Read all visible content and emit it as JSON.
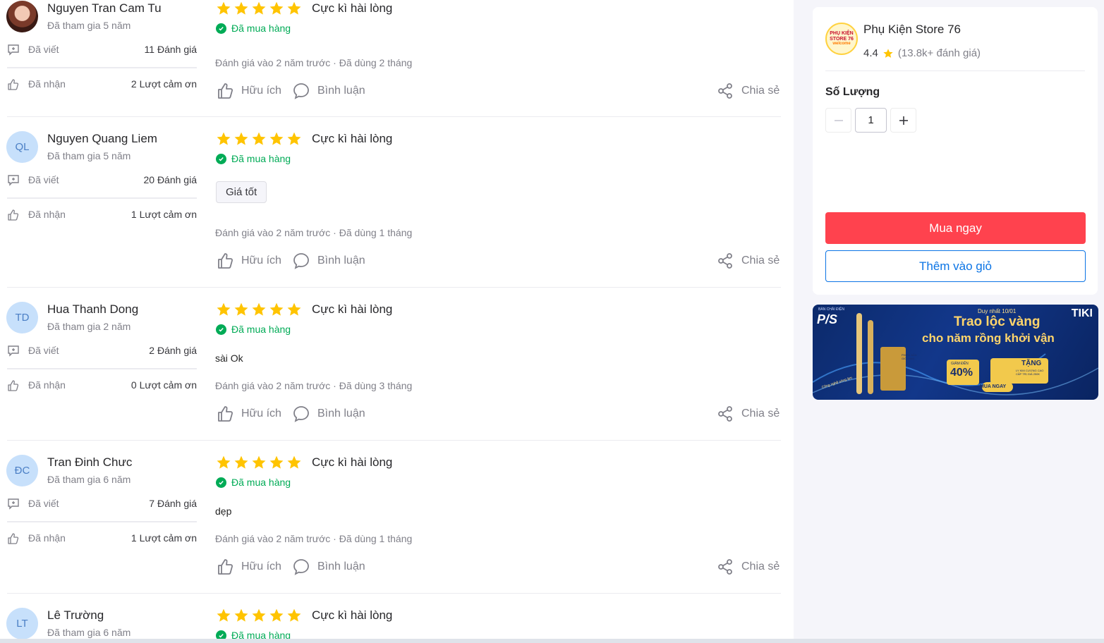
{
  "reviews": [
    {
      "name": "Nguyen Tran Cam Tu",
      "initials": "",
      "joined": "Đã tham gia 5 năm",
      "written_label": "Đã viết",
      "written_value": "11 Đánh giá",
      "received_label": "Đã nhận",
      "received_value": "2 Lượt cảm ơn",
      "rating": 5,
      "rating_title": "Cực kì hài lòng",
      "bought": "Đã mua hàng",
      "tag": "",
      "content": "",
      "meta": "Đánh giá vào 2 năm trước  ·  Đã dùng 2 tháng",
      "helpful": "Hữu ích",
      "comment": "Bình luận",
      "share": "Chia sẻ"
    },
    {
      "name": "Nguyen Quang Liem",
      "initials": "QL",
      "joined": "Đã tham gia 5 năm",
      "written_label": "Đã viết",
      "written_value": "20 Đánh giá",
      "received_label": "Đã nhận",
      "received_value": "1 Lượt cảm ơn",
      "rating": 5,
      "rating_title": "Cực kì hài lòng",
      "bought": "Đã mua hàng",
      "tag": "Giá tốt",
      "content": "",
      "meta": "Đánh giá vào 2 năm trước  ·  Đã dùng 1 tháng",
      "helpful": "Hữu ích",
      "comment": "Bình luận",
      "share": "Chia sẻ"
    },
    {
      "name": "Hua Thanh Dong",
      "initials": "TD",
      "joined": "Đã tham gia 2 năm",
      "written_label": "Đã viết",
      "written_value": "2 Đánh giá",
      "received_label": "Đã nhận",
      "received_value": "0 Lượt cảm ơn",
      "rating": 5,
      "rating_title": "Cực kì hài lòng",
      "bought": "Đã mua hàng",
      "tag": "",
      "content": "sài Ok",
      "meta": "Đánh giá vào 2 năm trước  ·  Đã dùng 3 tháng",
      "helpful": "Hữu ích",
      "comment": "Bình luận",
      "share": "Chia sẻ"
    },
    {
      "name": "Tran Đinh Chưc",
      "initials": "ĐC",
      "joined": "Đã tham gia 6 năm",
      "written_label": "Đã viết",
      "written_value": "7 Đánh giá",
      "received_label": "Đã nhận",
      "received_value": "1 Lượt cảm ơn",
      "rating": 5,
      "rating_title": "Cực kì hài lòng",
      "bought": "Đã mua hàng",
      "tag": "",
      "content": "dẹp",
      "meta": "Đánh giá vào 2 năm trước  ·  Đã dùng 1 tháng",
      "helpful": "Hữu ích",
      "comment": "Bình luận",
      "share": "Chia sẻ"
    },
    {
      "name": "Lê Trường",
      "initials": "LT",
      "joined": "Đã tham gia 6 năm",
      "rating": 5,
      "rating_title": "Cực kì hài lòng",
      "bought": "Đã mua hàng"
    }
  ],
  "store": {
    "logo_text": [
      "PHỤ KIỆN",
      "STORE 76",
      "welcome"
    ],
    "name": "Phụ Kiện Store 76",
    "rating": "4.4",
    "rating_count": "(13.8k+ đánh giá)"
  },
  "quantity": {
    "label": "Số Lượng",
    "value": "1",
    "minus": "−",
    "plus": "+"
  },
  "buttons": {
    "buy_now": "Mua ngay",
    "add_to_cart": "Thêm vào giỏ"
  },
  "banner": {
    "brand": "P/S",
    "brand_tag": "BÀN CHẢI ĐIỆN",
    "top_text": "Duy nhất 10/01",
    "tiki": "TIKI",
    "headline_1": "Trao lộc vàng",
    "headline_2": "cho năm rồng khởi vận",
    "discount_label": "GIẢM ĐẾN",
    "discount": "40%",
    "gift_label": "TẶNG",
    "gift_sub": "LY KIM CƯƠNG CAO CẤP TRỊ GIÁ 250K",
    "cta": "MUA NGAY",
    "edition": "PHIÊN BẢN GIỚI HẠN",
    "ribbon": "Công nghệ sóng âm"
  },
  "colors": {
    "star": "#ffc400",
    "bought": "#00ab56",
    "buy": "#ff424e",
    "cart_border": "#0b74e5"
  }
}
